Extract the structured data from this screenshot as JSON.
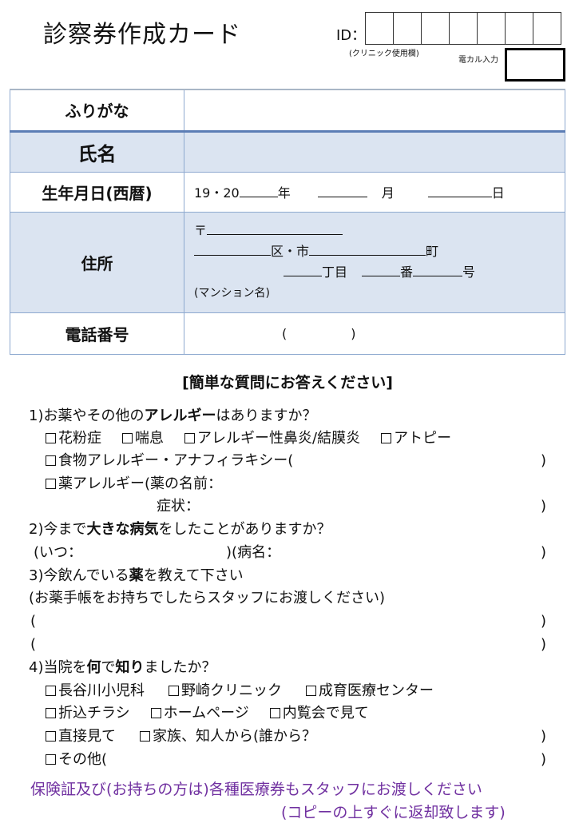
{
  "header": {
    "title": "診察券作成カード",
    "id_label": "ID：",
    "id_cells": 7,
    "clinic_note": "(クリニック使用欄)",
    "ekaru_label": "電カル入力"
  },
  "form": {
    "furigana_label": "ふりがな",
    "name_label": "氏名",
    "birth_label": "生年月日(西暦)",
    "birth_prefix": "19・20",
    "birth_year": "年",
    "birth_month": "月",
    "birth_day": "日",
    "address_label": "住所",
    "address_postal": "〒",
    "address_ku_shi": "区・市",
    "address_machi": "町",
    "address_chome": "丁目",
    "address_ban": "番",
    "address_go": "号",
    "address_mansion": "(マンション名)",
    "phone_label": "電話番号",
    "phone_open": "(",
    "phone_close": ")"
  },
  "questions": {
    "heading": "[簡単な質問にお答えください]",
    "q1": {
      "prefix": "1)お薬やその他の",
      "bold": "アレルギー",
      "suffix": "はありますか？",
      "options_row1": [
        "花粉症",
        "喘息",
        "アレルギー性鼻炎/結膜炎",
        "アトピー"
      ],
      "food_allergy": "食物アレルギー・アナフィラキシー(",
      "drug_allergy": "薬アレルギー(薬の名前：",
      "symptom": "症状：",
      "close": ")"
    },
    "q2": {
      "prefix": "2)今まで",
      "bold": "大きな病気",
      "suffix": "をしたことがありますか？",
      "when": "(いつ：",
      "mid": ")(病名：",
      "close": ")"
    },
    "q3": {
      "prefix": "3)今飲んでいる",
      "bold": "薬",
      "suffix": "を教えて下さい",
      "note": "(お薬手帳をお持ちでしたらスタッフにお渡しください)",
      "open": "(",
      "close": ")"
    },
    "q4": {
      "prefix": "4)当院を",
      "bold1": "何",
      "mid": "で",
      "bold2": "知り",
      "suffix": "ましたか？",
      "options_row1": [
        "長谷川小児科",
        "野崎クリニック",
        "成育医療センター"
      ],
      "options_row2": [
        "折込チラシ",
        "ホームページ",
        "内覧会で見て"
      ],
      "options_row3": [
        "直接見て",
        "家族、知人から(誰から？"
      ],
      "other": "その他(",
      "close": ")"
    }
  },
  "footer": {
    "line1": "保険証及び(お持ちの方は)各種医療券もスタッフにお渡しください",
    "line2": "(コピーの上すぐに返却致します)",
    "color": "#7030a0"
  }
}
